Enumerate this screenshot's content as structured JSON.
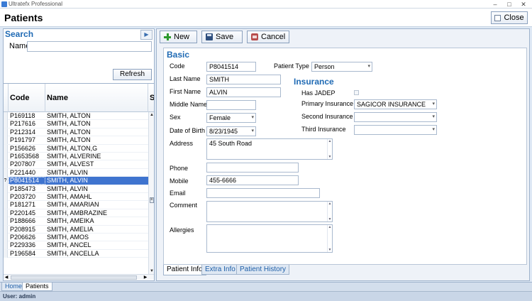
{
  "window": {
    "app_title": "Ultratefx Professional",
    "minimize": "–",
    "maximize": "□",
    "close": "✕"
  },
  "header": {
    "title": "Patients",
    "close_label": "Close"
  },
  "search": {
    "heading": "Search",
    "collapse_glyph": "▶",
    "name_label": "Name",
    "name_value": "",
    "refresh_label": "Refresh"
  },
  "grid": {
    "columns": [
      "Code",
      "Name",
      "Se"
    ],
    "rows": [
      {
        "code": "P169118",
        "name": "SMITH, ALTON"
      },
      {
        "code": "P217616",
        "name": "SMITH, ALTON"
      },
      {
        "code": "P212314",
        "name": "SMITH, ALTON"
      },
      {
        "code": "P191797",
        "name": "SMITH, ALTON"
      },
      {
        "code": "P156626",
        "name": "SMITH, ALTON,G"
      },
      {
        "code": "P1653568",
        "name": "SMITH, ALVERINE"
      },
      {
        "code": "P207807",
        "name": "SMITH, ALVEST"
      },
      {
        "code": "P221440",
        "name": "SMITH, ALVIN"
      },
      {
        "code": "P8041514",
        "name": "SMITH, ALVIN",
        "selected": true
      },
      {
        "code": "P185473",
        "name": "SMITH, ALVIN"
      },
      {
        "code": "P203720",
        "name": "SMITH, AMAHL"
      },
      {
        "code": "P181271",
        "name": "SMITH, AMARIAN"
      },
      {
        "code": "P220145",
        "name": "SMITH, AMBRAZINE"
      },
      {
        "code": "P188666",
        "name": "SMITH, AMEIKA"
      },
      {
        "code": "P208915",
        "name": "SMITH, AMELIA"
      },
      {
        "code": "P206626",
        "name": "SMITH, AMOS"
      },
      {
        "code": "P229336",
        "name": "SMITH, ANCEL"
      },
      {
        "code": "P196584",
        "name": "SMITH, ANCELLA"
      }
    ],
    "selected_marker": "?"
  },
  "toolbar": {
    "new_label": "New",
    "save_label": "Save",
    "cancel_label": "Cancel"
  },
  "form": {
    "basic_heading": "Basic",
    "code_label": "Code",
    "code_value": "P8041514",
    "patient_type_label": "Patient Type",
    "patient_type_value": "Person",
    "last_name_label": "Last Name",
    "last_name_value": "SMITH",
    "first_name_label": "First Name",
    "first_name_value": "ALVIN",
    "middle_name_label": "Middle Name",
    "middle_name_value": "",
    "sex_label": "Sex",
    "sex_value": "Female",
    "dob_label": "Date of Birth",
    "dob_value": "8/23/1945",
    "address_label": "Address",
    "address_value": "45 South Road",
    "phone_label": "Phone",
    "phone_value": "",
    "mobile_label": "Mobile",
    "mobile_value": "455-6666",
    "email_label": "Email",
    "email_value": "",
    "comment_label": "Comment",
    "comment_value": "",
    "allergies_label": "Allergies",
    "allergies_value": "",
    "insurance_heading": "Insurance",
    "has_jadep_label": "Has JADEP",
    "primary_ins_label": "Primary Insurance",
    "primary_ins_value": "SAGICOR INSURANCE",
    "second_ins_label": "Second Insurance",
    "second_ins_value": "",
    "third_ins_label": "Third Insurance",
    "third_ins_value": ""
  },
  "tabs": [
    "Patient Info",
    "Extra Info",
    "Patient History"
  ],
  "bottom_tabs": [
    "Home",
    "Patients"
  ],
  "status": {
    "user": "User: admin"
  }
}
